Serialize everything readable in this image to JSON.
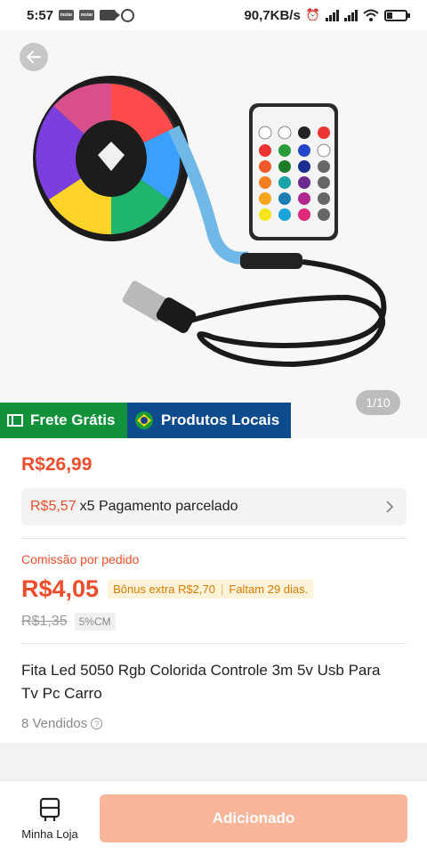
{
  "status_bar": {
    "time": "5:57",
    "network_speed": "90,7KB/s",
    "icons": [
      "notification-icon",
      "notification-icon",
      "video-camera-icon",
      "whatsapp-icon",
      "alarm-icon",
      "signal-icon",
      "signal-icon",
      "wifi-icon",
      "battery-icon"
    ]
  },
  "gallery": {
    "counter": "1/10",
    "back_icon": "arrow-left-icon"
  },
  "badges": {
    "frete": "Frete Grátis",
    "locais": "Produtos Locais"
  },
  "product": {
    "price": "R$26,99",
    "installment_value": "R$5,57",
    "installment_text": "x5 Pagamento parcelado",
    "commission_label": "Comissão por pedido",
    "commission_value": "R$4,05",
    "bonus_text": "Bônus extra R$2,70",
    "days_left": "Faltam 29 dias.",
    "old_commission": "R$1,35",
    "commission_rate": "5%CM",
    "title": "Fita Led 5050 Rgb Colorida Controle 3m 5v Usb Para Tv Pc Carro",
    "sold": "8 Vendidos"
  },
  "bottom_bar": {
    "store_label": "Minha Loja",
    "add_button": "Adicionado"
  },
  "colors": {
    "accent": "#ee4d2d",
    "frete_green": "#12913b",
    "locais_blue": "#0d4b8c",
    "button_disabled": "#f9b69a"
  }
}
